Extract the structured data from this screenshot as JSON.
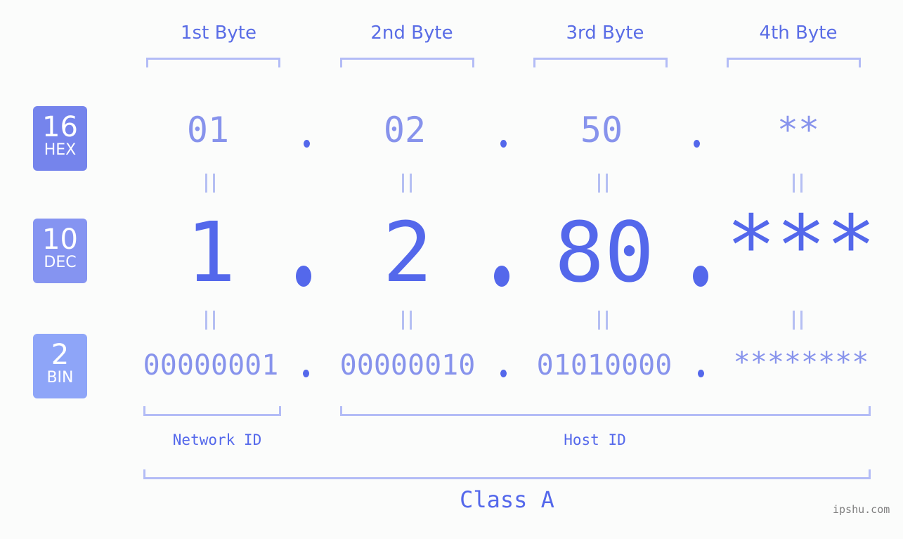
{
  "byte_headers": [
    "1st Byte",
    "2nd Byte",
    "3rd Byte",
    "4th Byte"
  ],
  "badges": {
    "hex": {
      "number": "16",
      "label": "HEX",
      "color": "#7584ec"
    },
    "dec": {
      "number": "10",
      "label": "DEC",
      "color": "#8594f1"
    },
    "bin": {
      "number": "2",
      "label": "BIN",
      "color": "#8ea5f8"
    }
  },
  "hex_values": [
    "01",
    "02",
    "50",
    "**"
  ],
  "dec_values": [
    "1",
    "2",
    "80",
    "***"
  ],
  "bin_values": [
    "00000001",
    "00000010",
    "01010000",
    "********"
  ],
  "separator": ".",
  "equals_symbol": "=",
  "network_id_label": "Network ID",
  "host_id_label": "Host ID",
  "class_label": "Class A",
  "watermark": "ipshu.com",
  "colors": {
    "accent": "#5468eb",
    "light_value": "#8793ec",
    "bracket": "#b3bcf6",
    "background": "#fbfcfb"
  }
}
